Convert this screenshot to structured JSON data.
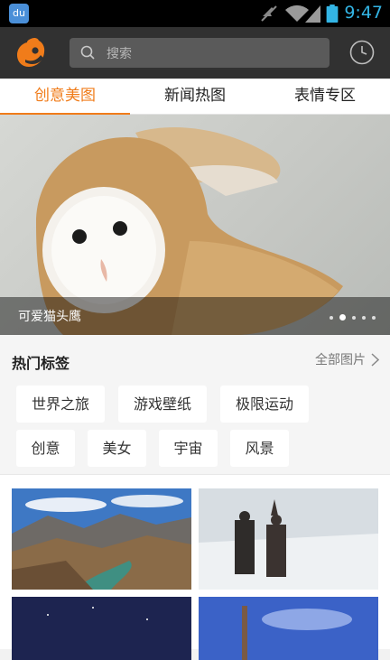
{
  "status_bar": {
    "time": "9:47",
    "notification_icon_text": "du",
    "icons": [
      "baidu-icon",
      "mute-icon",
      "wifi-icon",
      "signal-icon",
      "battery-icon"
    ]
  },
  "header": {
    "search": {
      "placeholder": "搜索"
    },
    "icons": [
      "app-logo-icon",
      "search-icon",
      "history-clock-icon"
    ]
  },
  "tabs": [
    {
      "label": "创意美图",
      "active": true
    },
    {
      "label": "新闻热图",
      "active": false
    },
    {
      "label": "表情专区",
      "active": false
    }
  ],
  "banner": {
    "caption": "可爱猫头鹰",
    "page_count": 5,
    "current_page": 2
  },
  "hot_tags": {
    "title": "热门标签",
    "all_link": "全部图片",
    "tags": [
      "世界之旅",
      "游戏壁纸",
      "极限运动",
      "创意",
      "美女",
      "宇宙",
      "风景"
    ]
  },
  "gallery": {
    "items": [
      "mountain-valley-photo",
      "snow-pilgrims-photo",
      "night-sky-photo",
      "blue-sky-tower-photo"
    ]
  },
  "colors": {
    "accent": "#f07c1a",
    "appbar": "#313131",
    "status_blue": "#33b5e5"
  }
}
